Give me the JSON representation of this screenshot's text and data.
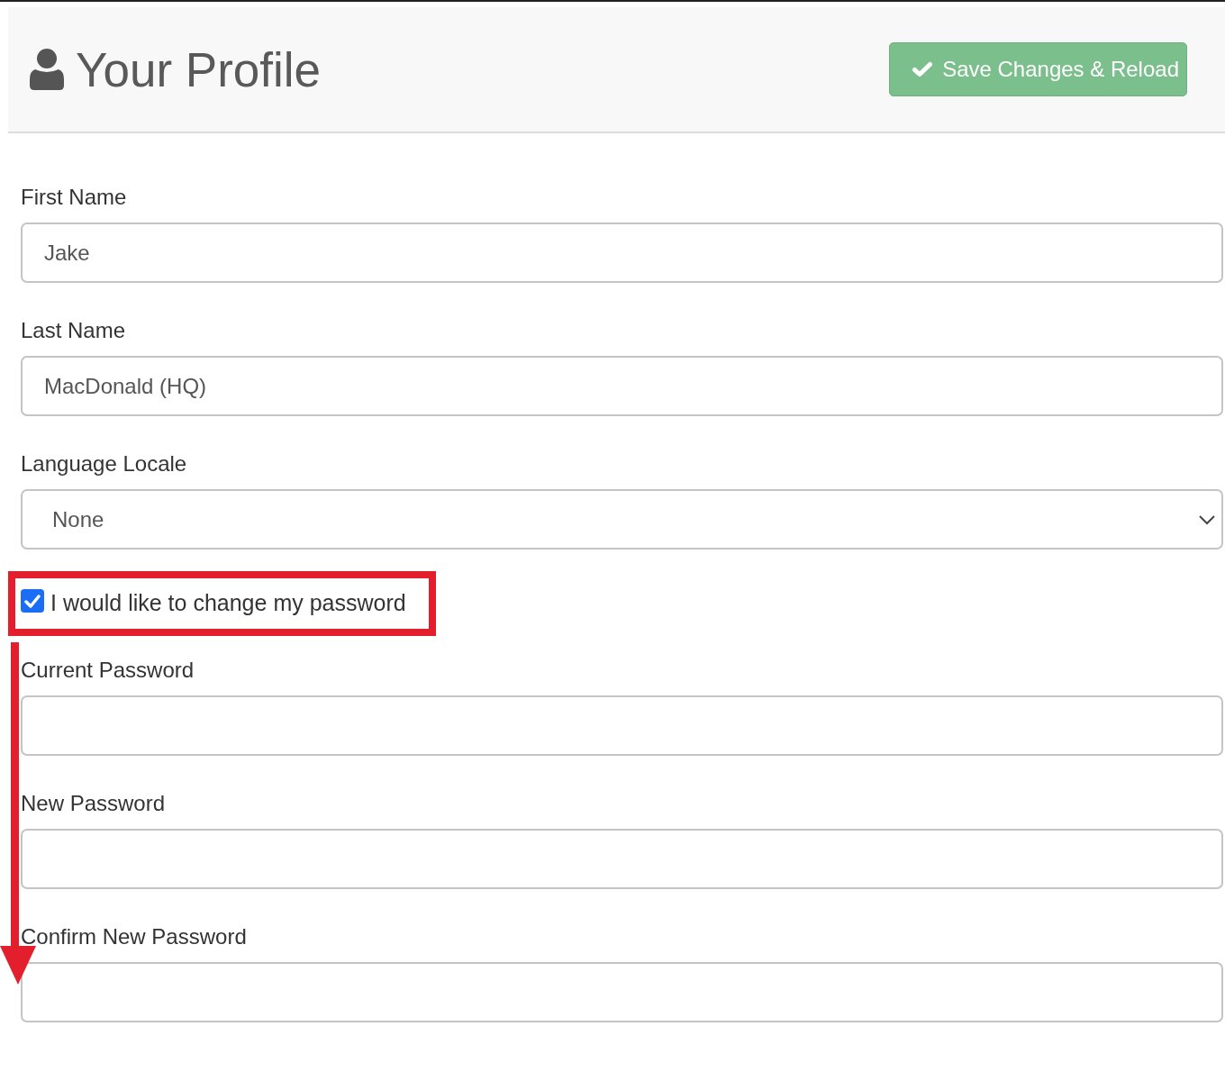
{
  "header": {
    "title": "Your Profile",
    "save_button": "Save Changes & Reload"
  },
  "fields": [
    {
      "kind": "text",
      "label": "First Name",
      "value": "Jake"
    },
    {
      "kind": "text",
      "label": "Last Name",
      "value": "MacDonald (HQ)"
    },
    {
      "kind": "select",
      "label": "Language Locale",
      "value": "None"
    }
  ],
  "change_password": {
    "label": "I would like to change my password",
    "checked": true
  },
  "password_fields": [
    {
      "kind": "password",
      "label": "Current Password"
    },
    {
      "kind": "password",
      "label": "New Password"
    },
    {
      "kind": "password",
      "label": "Confirm New Password"
    }
  ]
}
